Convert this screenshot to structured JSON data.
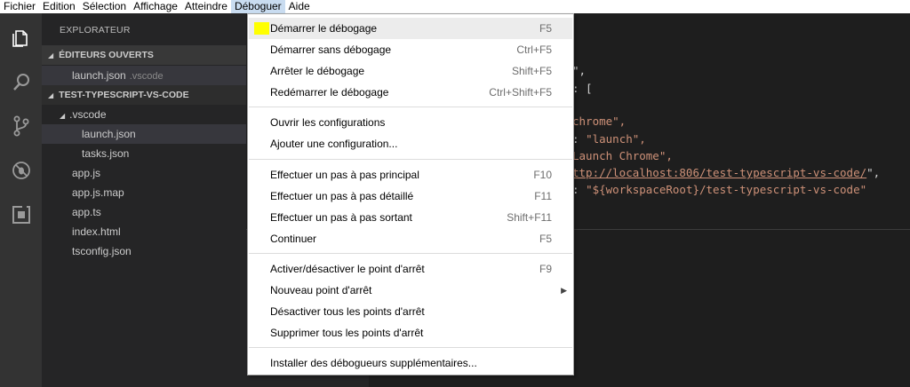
{
  "menubar": {
    "items": [
      "Fichier",
      "Edition",
      "Sélection",
      "Affichage",
      "Atteindre",
      "Déboguer",
      "Aide"
    ],
    "active": "Déboguer"
  },
  "activity_bar": {
    "icons": [
      "files-icon",
      "search-icon",
      "source-control-icon",
      "debug-icon",
      "extensions-icon"
    ]
  },
  "sidebar": {
    "title": "EXPLORATEUR",
    "open_editors_header": "ÉDITEURS OUVERTS",
    "open_editor": {
      "name": "launch.json",
      "folder": ".vscode"
    },
    "project_header": "TEST-TYPESCRIPT-VS-CODE",
    "tree": {
      "folder": ".vscode",
      "folder_files": [
        "launch.json",
        "tasks.json"
      ],
      "root_files": [
        "app.js",
        "app.js.map",
        "app.ts",
        "index.html",
        "tsconfig.json"
      ]
    }
  },
  "editor": {
    "lines": [
      {
        "plain": "\",",
        "str": ""
      },
      {
        "plain": ": [",
        "str": ""
      },
      {
        "plain": "",
        "str": "chrome\","
      },
      {
        "plain": ": ",
        "str": "\"launch\","
      },
      {
        "plain": "",
        "str": "Launch Chrome\","
      },
      {
        "plain": "",
        "url": "ttp://localhost:806/test-typescript-vs-code/",
        "tail": "\","
      },
      {
        "plain": ": ",
        "str": "\"${workspaceRoot}/test-typescript-vs-code\""
      }
    ]
  },
  "debug_menu": {
    "groups": [
      [
        {
          "label": "Démarrer le débogage",
          "shortcut": "F5"
        },
        {
          "label": "Démarrer sans débogage",
          "shortcut": "Ctrl+F5"
        },
        {
          "label": "Arrêter le débogage",
          "shortcut": "Shift+F5"
        },
        {
          "label": "Redémarrer le débogage",
          "shortcut": "Ctrl+Shift+F5"
        }
      ],
      [
        {
          "label": "Ouvrir les configurations",
          "shortcut": ""
        },
        {
          "label": "Ajouter une configuration...",
          "shortcut": ""
        }
      ],
      [
        {
          "label": "Effectuer un pas à pas principal",
          "shortcut": "F10"
        },
        {
          "label": "Effectuer un pas à pas détaillé",
          "shortcut": "F11"
        },
        {
          "label": "Effectuer un pas à pas sortant",
          "shortcut": "Shift+F11"
        },
        {
          "label": "Continuer",
          "shortcut": "F5"
        }
      ],
      [
        {
          "label": "Activer/désactiver le point d'arrêt",
          "shortcut": "F9"
        },
        {
          "label": "Nouveau point d'arrêt",
          "shortcut": "",
          "submenu": true
        },
        {
          "label": "Désactiver tous les points d'arrêt",
          "shortcut": ""
        },
        {
          "label": "Supprimer tous les points d'arrêt",
          "shortcut": ""
        }
      ],
      [
        {
          "label": "Installer des débogueurs supplémentaires...",
          "shortcut": ""
        }
      ]
    ]
  }
}
